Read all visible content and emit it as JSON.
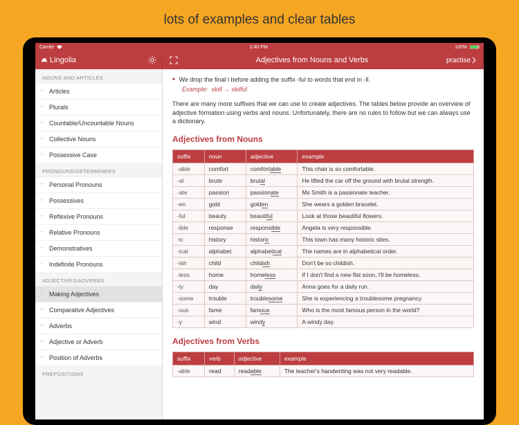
{
  "promo": {
    "title": "lots of examples and clear tables"
  },
  "statusbar": {
    "carrier": "Carrier",
    "time": "2:40 PM",
    "battery": "100%"
  },
  "header": {
    "brand": "Lingolia",
    "page_title": "Adjectives from Nouns and Verbs",
    "practise": "practise"
  },
  "sidebar": {
    "sections": [
      {
        "title": "Nouns and Articles",
        "items": [
          "Articles",
          "Plurals",
          "Countable/Uncountable Nouns",
          "Collective Nouns",
          "Possessive Case"
        ]
      },
      {
        "title": "Pronouns/Determiners",
        "items": [
          "Personal Pronouns",
          "Possessives",
          "Reflexive Pronouns",
          "Relative Pronouns",
          "Demonstratives",
          "Indefinite Pronouns"
        ]
      },
      {
        "title": "Adjectives/Adverbs",
        "items": [
          "Making Adjectives",
          "Comparative Adjectives",
          "Adverbs",
          "Adjective or Adverb",
          "Position of Adverbs"
        ],
        "selected": 0
      },
      {
        "title": "Prepositions",
        "items": []
      }
    ]
  },
  "article": {
    "bullet1": "We drop the final l before adding the suffix -ful to words that end in -ll.",
    "example_label": "Example:",
    "example_text": "skill → skilful",
    "intro": "There are many more suffixes that we can use to create adjectives. The tables below provide an overview of adjective formation using verbs and nouns. Unfortunately, there are no rules to follow but we can always use a dictionary.",
    "section1_title": "Adjectives from Nouns",
    "table1": {
      "headers": [
        "suffix",
        "noun",
        "adjective",
        "example"
      ],
      "rows": [
        [
          "-able",
          "comfort",
          "comfortable",
          "This chair is so comfortable."
        ],
        [
          "-al",
          "brute",
          "brutal",
          "He lifted the car off the ground with brutal strength."
        ],
        [
          "-ate",
          "passion",
          "passionate",
          "Ms Smith is a passionate teacher."
        ],
        [
          "-en",
          "gold",
          "golden",
          "She wears a golden bracelet."
        ],
        [
          "-ful",
          "beauty",
          "beautiful",
          "Look at those beautiful flowers."
        ],
        [
          "-ible",
          "response",
          "responsible",
          "Angela is very responsible."
        ],
        [
          "-ic",
          "history",
          "historic",
          "This town has many historic sites."
        ],
        [
          "-ical",
          "alphabet",
          "alphabetical",
          "The names are in alphabetical order."
        ],
        [
          "-ish",
          "child",
          "childish",
          "Don't be so childish."
        ],
        [
          "-less",
          "home",
          "homeless",
          "If I don't find a new flat soon, I'll be homeless."
        ],
        [
          "-ly",
          "day",
          "daily",
          "Anna goes for a daily run."
        ],
        [
          "-some",
          "trouble",
          "troublesome",
          "She is experiencing a troublesome pregnancy."
        ],
        [
          "-ous",
          "fame",
          "famous",
          "Who is the most famous person in the world?"
        ],
        [
          "-y",
          "wind",
          "windy",
          "A windy day."
        ]
      ]
    },
    "section2_title": "Adjectives from Verbs",
    "table2": {
      "headers": [
        "suffix",
        "verb",
        "adjective",
        "example"
      ],
      "rows": [
        [
          "-able",
          "read",
          "readable",
          "The teacher's handwriting was not very readable."
        ]
      ]
    }
  }
}
